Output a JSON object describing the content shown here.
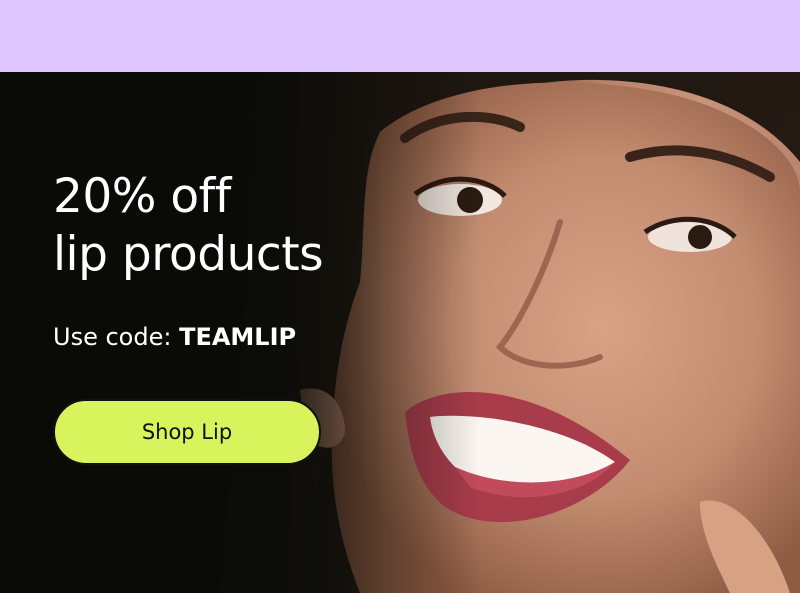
{
  "promo": {
    "headline_line1": "20% off",
    "headline_line2": "lip products",
    "code_prefix": "Use code:",
    "code": "TEAMLIP",
    "cta_label": "Shop Lip"
  },
  "colors": {
    "top_band": "#dfc6ff",
    "cta_background": "#d9f35c",
    "text": "#ffffff"
  }
}
